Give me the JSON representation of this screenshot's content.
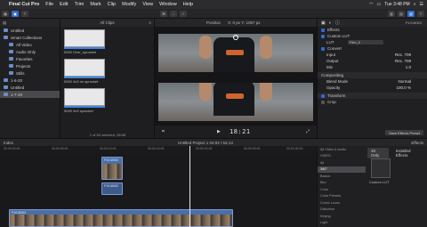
{
  "menubar": {
    "app": "Final Cut Pro",
    "items": [
      "File",
      "Edit",
      "Trim",
      "Mark",
      "Clip",
      "Modify",
      "View",
      "Window",
      "Help"
    ],
    "clock": "Tue 3:48 PM"
  },
  "libraries": {
    "items": [
      {
        "label": "Untitled",
        "sub": false,
        "sel": false
      },
      {
        "label": "Smart Collections",
        "sub": false,
        "sel": false
      },
      {
        "label": "All Video",
        "sub": true,
        "sel": false
      },
      {
        "label": "Audio Only",
        "sub": true,
        "sel": false
      },
      {
        "label": "Favorites",
        "sub": true,
        "sel": false
      },
      {
        "label": "Projects",
        "sub": true,
        "sel": false
      },
      {
        "label": "Stills",
        "sub": true,
        "sel": false
      },
      {
        "label": "1-6-20",
        "sub": false,
        "sel": false
      },
      {
        "label": "Untitled",
        "sub": false,
        "sel": false
      },
      {
        "label": "1-7-20",
        "sub": false,
        "sel": true
      }
    ]
  },
  "browser": {
    "filter": "All Clips",
    "clips": [
      {
        "label": "5000 Over_sprocket"
      },
      {
        "label": "5000 4x3 no sprocket"
      },
      {
        "label": "5000 4x3 sprocket"
      }
    ],
    "footer": "1 of 60 selected, 06:08"
  },
  "viewer": {
    "position_label": "Position",
    "x": "X: 0 px",
    "y": "Y: 1057 px",
    "timecode": "18:21"
  },
  "inspector": {
    "clip_name": "P1018063",
    "effects_label": "Effects",
    "custom_lut": "Custom LUT",
    "lut_label": "LUT",
    "lut_value": "Film_ll",
    "convert_label": "Convert",
    "input_label": "Input",
    "input_value": "Rec. 709",
    "output_label": "Output",
    "output_value": "Rec. 709",
    "mix_label": "Mix",
    "mix_value": "1.0",
    "compositing_label": "Compositing",
    "blend_label": "Blend Mode",
    "blend_value": "Normal",
    "opacity_label": "Opacity",
    "opacity_value": "100.0 %",
    "transform_label": "Transform",
    "crop_label": "Crop",
    "save_label": "Save Effects Preset"
  },
  "timeline": {
    "index_label": "Index",
    "project_title": "Untitled Project 1",
    "project_time": "04:02 / 53:14",
    "ruler": [
      "00:00:00:00",
      "00:00:05:00",
      "00:00:10:00",
      "00:00:15:00",
      "00:00:20:00",
      "00:00:25:00",
      "00:00:30:00"
    ],
    "clip_label": "P1018063",
    "connected_label": "P1018062"
  },
  "effects": {
    "header": "Effects",
    "tab_4k": "4K Only",
    "tab_installed": "Installed Effects",
    "categories": [
      "All Video & Audio",
      "VIDEO",
      "All",
      "360°",
      "Basics",
      "Blur",
      "Color",
      "Color Presets",
      "Comic Looks",
      "Distortion",
      "Keying",
      "Light"
    ],
    "selected_index": 3,
    "thumb_label": "Custom LUT"
  }
}
